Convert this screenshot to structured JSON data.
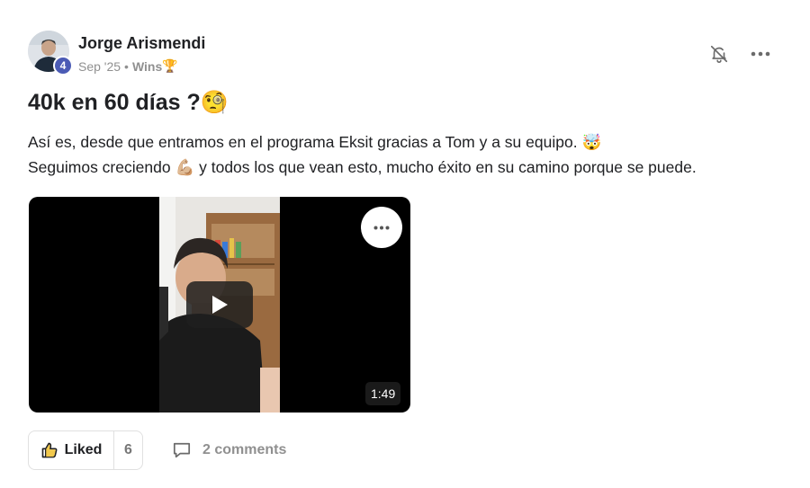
{
  "author": {
    "name": "Jorge Arismendi",
    "level": "4",
    "date": "Sep '25",
    "separator": "•",
    "category": "Wins",
    "category_emoji": "🏆"
  },
  "post": {
    "title": "40k en 60 días ?",
    "title_emoji": "🧐",
    "body_line_1": "Así es, desde que entramos en el programa Eksit gracias a Tom y a su equipo.",
    "body_line_1_emoji": "🤯",
    "body_line_2_a": "Seguimos creciendo",
    "body_line_2_emoji": "💪🏼",
    "body_line_2_b": "y todos los que vean esto, mucho éxito en su camino porque se puede."
  },
  "video": {
    "duration": "1:49"
  },
  "footer": {
    "like_label": "Liked",
    "like_count": "6",
    "comments_label": "2 comments"
  },
  "icons": {
    "bell": "bell-off-icon",
    "more": "more-horizontal-icon",
    "like": "thumbs-up-icon",
    "comment": "comment-bubble-icon",
    "play": "play-icon"
  },
  "colors": {
    "level_badge": "#4b5bb5",
    "muted_text": "#909090",
    "border": "#e0e0e0"
  }
}
